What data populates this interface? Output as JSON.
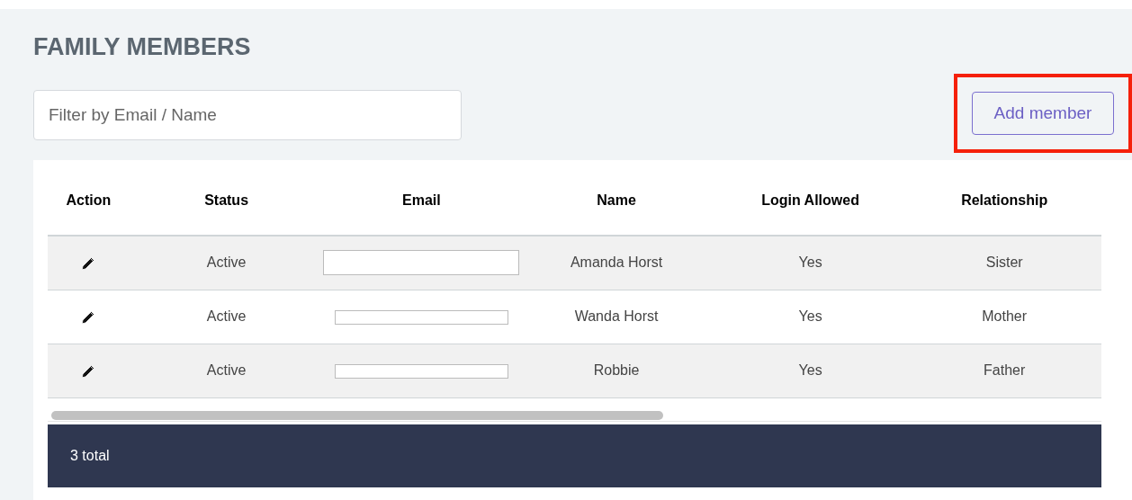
{
  "title": "FAMILY MEMBERS",
  "filter": {
    "placeholder": "Filter by Email / Name"
  },
  "add_button": {
    "label": "Add member",
    "highlighted": true
  },
  "table": {
    "columns": [
      "Action",
      "Status",
      "Email",
      "Name",
      "Login Allowed",
      "Relationship"
    ],
    "rows": [
      {
        "status": "Active",
        "email_redacted": true,
        "name": "Amanda Horst",
        "login_allowed": "Yes",
        "relationship": "Sister"
      },
      {
        "status": "Active",
        "email_redacted": true,
        "name": "Wanda Horst",
        "login_allowed": "Yes",
        "relationship": "Mother"
      },
      {
        "status": "Active",
        "email_redacted": true,
        "name": "Robbie",
        "login_allowed": "Yes",
        "relationship": "Father"
      }
    ]
  },
  "footer": {
    "total": "3 total"
  }
}
